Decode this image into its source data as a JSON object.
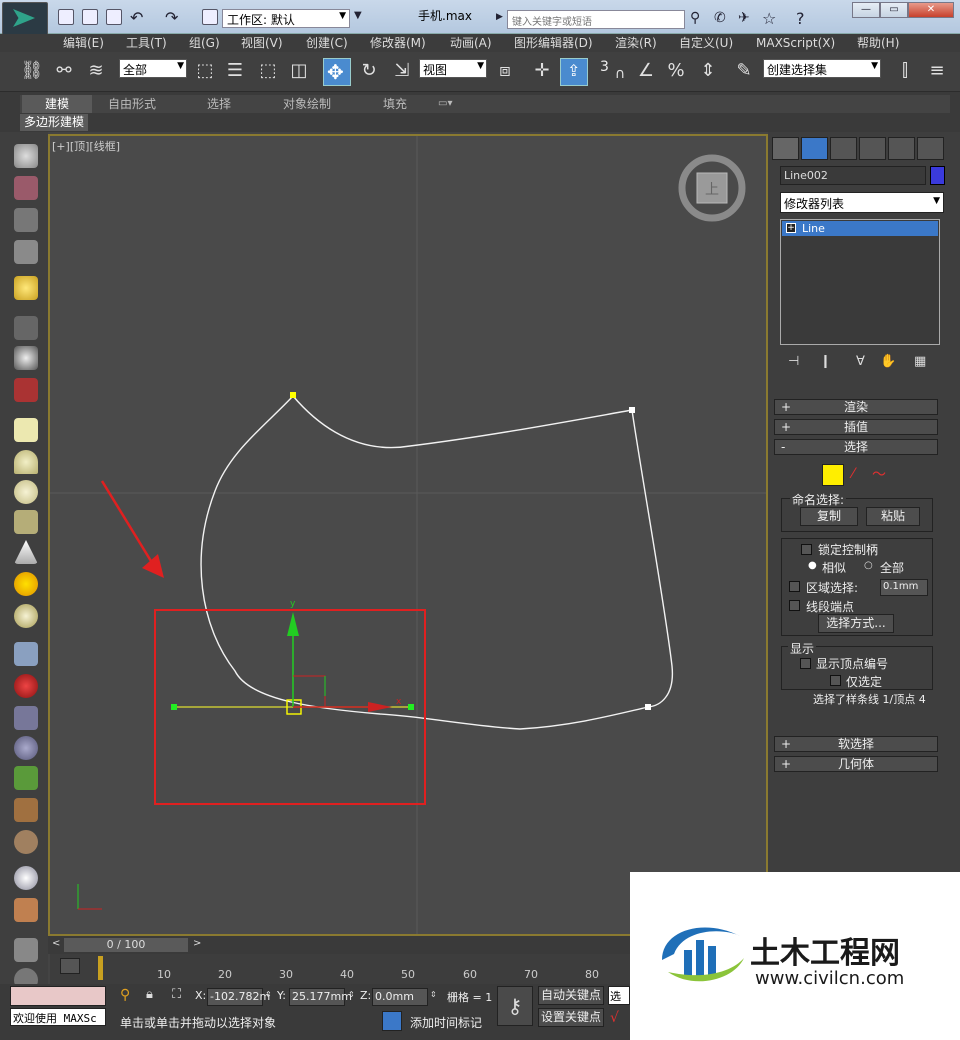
{
  "titlebar": {
    "workspace_label": "工作区: 默认",
    "file_title": "手机.max",
    "search_placeholder": "键入关键字或短语"
  },
  "menu": [
    "编辑(E)",
    "工具(T)",
    "组(G)",
    "视图(V)",
    "创建(C)",
    "修改器(M)",
    "动画(A)",
    "图形编辑器(D)",
    "渲染(R)",
    "自定义(U)",
    "MAXScript(X)",
    "帮助(H)"
  ],
  "toolbar": {
    "selection_filter": "全部",
    "ref_coord": "视图",
    "angle_snap": "3",
    "named_sel_set": "创建选择集"
  },
  "ribbon": {
    "tabs": [
      "建模",
      "自由形式",
      "选择",
      "对象绘制",
      "填充"
    ],
    "sub_label": "多边形建模"
  },
  "viewport": {
    "label_plus": "[+]",
    "label_view": "[顶]",
    "label_shading": "[线框]",
    "viewcube_face": "上",
    "gizmo_y": "y",
    "gizmo_x": "x"
  },
  "command_panel": {
    "object_name": "Line002",
    "object_color": "#3a3adc",
    "modifier_list": "修改器列表",
    "stack_item": "Line",
    "rollouts": {
      "render": "渲染",
      "interp": "插值",
      "select": "选择",
      "soft_select": "软选择",
      "geometry": "几何体"
    },
    "named_selection": "命名选择:",
    "copy": "复制",
    "paste": "粘贴",
    "lock_handles": "锁定控制柄",
    "similar": "相似",
    "all": "全部",
    "area_select": "区域选择:",
    "area_value": "0.1mm",
    "segment_end": "线段端点",
    "select_by": "选择方式...",
    "display": "显示",
    "show_vertex_numbers": "显示顶点编号",
    "selected_only": "仅选定",
    "selection_status": "选择了样条线 1/顶点 4"
  },
  "timeline": {
    "slider": "0 / 100",
    "ticks": [
      "10",
      "20",
      "30",
      "40",
      "50",
      "60",
      "70",
      "80"
    ]
  },
  "status": {
    "maxscript": "欢迎使用 MAXSc",
    "prompt": "单击或单击并拖动以选择对象",
    "x_label": "X:",
    "x_value": "-102.782m",
    "y_label": "Y:",
    "y_value": "25.177mm",
    "z_label": "Z:",
    "z_value": "0.0mm",
    "grid": "栅格 = 1",
    "auto_key": "自动关键点",
    "set_key": "设置关键点",
    "add_time_tag": "添加时间标记",
    "selected": "选定"
  },
  "watermark": {
    "name": "土木工程网",
    "url": "www.civilcn.com"
  }
}
